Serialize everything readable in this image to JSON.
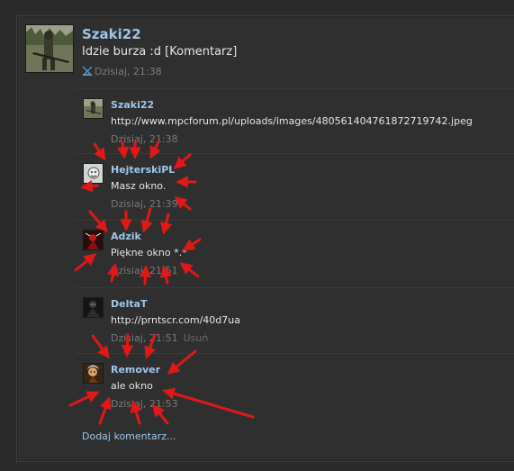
{
  "post": {
    "username": "Szaki22",
    "text": "Idzie burza :d [Komentarz]",
    "timestamp": "Dzisiaj, 21:38",
    "avatar_icon": "soldier-avatar-icon",
    "meta_icon": "connection-icon"
  },
  "comments": [
    {
      "username": "Szaki22",
      "text": "http://www.mpcforum.pl/uploads/images/480561404761872719742.jpeg",
      "timestamp": "Dzisiaj, 21:38",
      "delete": "",
      "avatar_icon": "soldier-avatar-icon"
    },
    {
      "username": "HejterskiPL",
      "text": "Masz okno.",
      "timestamp": "Dzisiaj, 21:39",
      "delete": "",
      "avatar_icon": "face-avatar-icon"
    },
    {
      "username": "Adzik",
      "text": "Piękne okno *.*",
      "timestamp": "Dzisiaj, 21:51",
      "delete": "",
      "avatar_icon": "red-character-avatar-icon"
    },
    {
      "username": "DeltaT",
      "text": "http://prntscr.com/40d7ua",
      "timestamp": "Dzisiaj, 21:51",
      "delete": "Usuń",
      "avatar_icon": "dark-figure-avatar-icon"
    },
    {
      "username": "Remover",
      "text": "ale okno",
      "timestamp": "Dzisiaj, 21:53",
      "delete": "",
      "avatar_icon": "character-avatar-icon"
    }
  ],
  "add_comment": "Dodaj komentarz...",
  "colors": {
    "username": "#9ec6e8",
    "annotation_arrows": "#e01818"
  }
}
